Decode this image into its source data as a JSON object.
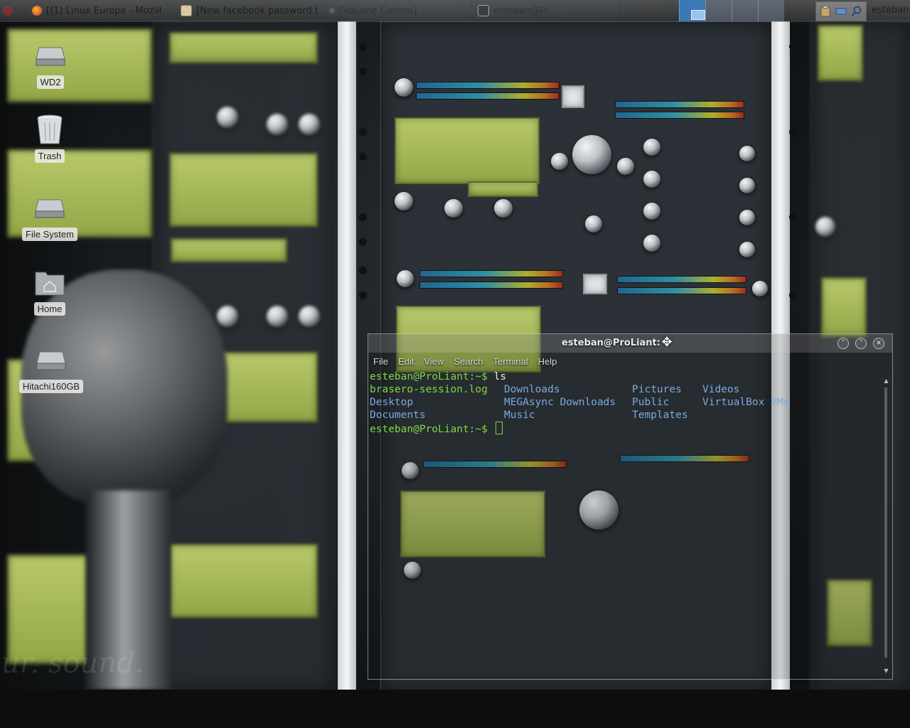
{
  "taskbar": {
    "tasks": [
      {
        "title": "[(1) Linux Europe - Mozill",
        "icon": "firefox-icon"
      },
      {
        "title": "[New facebook password.t",
        "icon": "text-editor-icon"
      },
      {
        "title": "[Volume Control]",
        "icon": "volume-icon"
      },
      {
        "title": "esteban@Pr",
        "icon": "terminal-icon"
      }
    ],
    "user": "esteban"
  },
  "desktop_icons": [
    {
      "label": "WD2",
      "icon": "drive-icon"
    },
    {
      "label": "Trash",
      "icon": "trash-icon"
    },
    {
      "label": "File System",
      "icon": "drive-icon"
    },
    {
      "label": "Home",
      "icon": "home-folder-icon"
    },
    {
      "label": "Hitachi160GB",
      "icon": "drive-icon"
    }
  ],
  "wallpaper": {
    "slogan": "ur. sound."
  },
  "terminal": {
    "title": "esteban@ProLiant: ~",
    "menu": [
      "File",
      "Edit",
      "View",
      "Search",
      "Terminal",
      "Help"
    ],
    "prompt": "esteban@ProLiant:~$",
    "command": " ls",
    "listing": {
      "row1": [
        "brasero-session.log",
        "Downloads",
        "Pictures",
        "Videos"
      ],
      "row2": [
        "Desktop",
        "MEGAsync Downloads",
        "Public",
        "VirtualBox VMs"
      ],
      "row3": [
        "Documents",
        "Music",
        "Templates"
      ]
    }
  },
  "colors": {
    "prompt_green": "#7dd845",
    "directory_blue": "#7aa9e0",
    "workspace_active": "#3b78b6"
  }
}
